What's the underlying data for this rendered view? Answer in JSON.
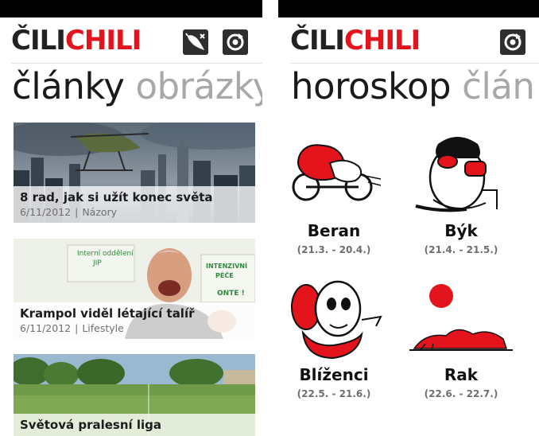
{
  "left": {
    "logo": {
      "part1": "ČILI",
      "part2": "CHILI"
    },
    "icons": [
      "chili-rate-icon",
      "refresh-icon"
    ],
    "pivot": {
      "active": "články",
      "next": "obrázky"
    },
    "articles": [
      {
        "title": "8 rad, jak si užít konec světa",
        "date": "6/11/2012",
        "category": "Názory"
      },
      {
        "title": "Krampol viděl létající talíř",
        "date": "6/11/2012",
        "category": "Lifestyle"
      },
      {
        "title": "Světová pralesní liga",
        "date": "",
        "category": ""
      }
    ],
    "sign_text": {
      "line1": "Interní oddělení",
      "line2": "JIP",
      "line3": "INTENZIVNÍ",
      "line4": "PÉČE",
      "line5": "ONTE !"
    }
  },
  "right": {
    "logo": {
      "part1": "ČILI",
      "part2": "CHILI"
    },
    "icons": [
      "refresh-icon"
    ],
    "pivot": {
      "active": "horoskop",
      "next": "člán"
    },
    "signs": [
      {
        "name": "Beran",
        "dates": "(21.3. - 20.4.)"
      },
      {
        "name": "Býk",
        "dates": "(21.4. - 21.5.)"
      },
      {
        "name": "Blíženci",
        "dates": "(22.5. - 21.6.)"
      },
      {
        "name": "Rak",
        "dates": "(22.6. - 22.7.)"
      }
    ]
  },
  "colors": {
    "brand_red": "#e3141c",
    "dark": "#222222",
    "muted": "#a8a8a8"
  },
  "sep": "|"
}
